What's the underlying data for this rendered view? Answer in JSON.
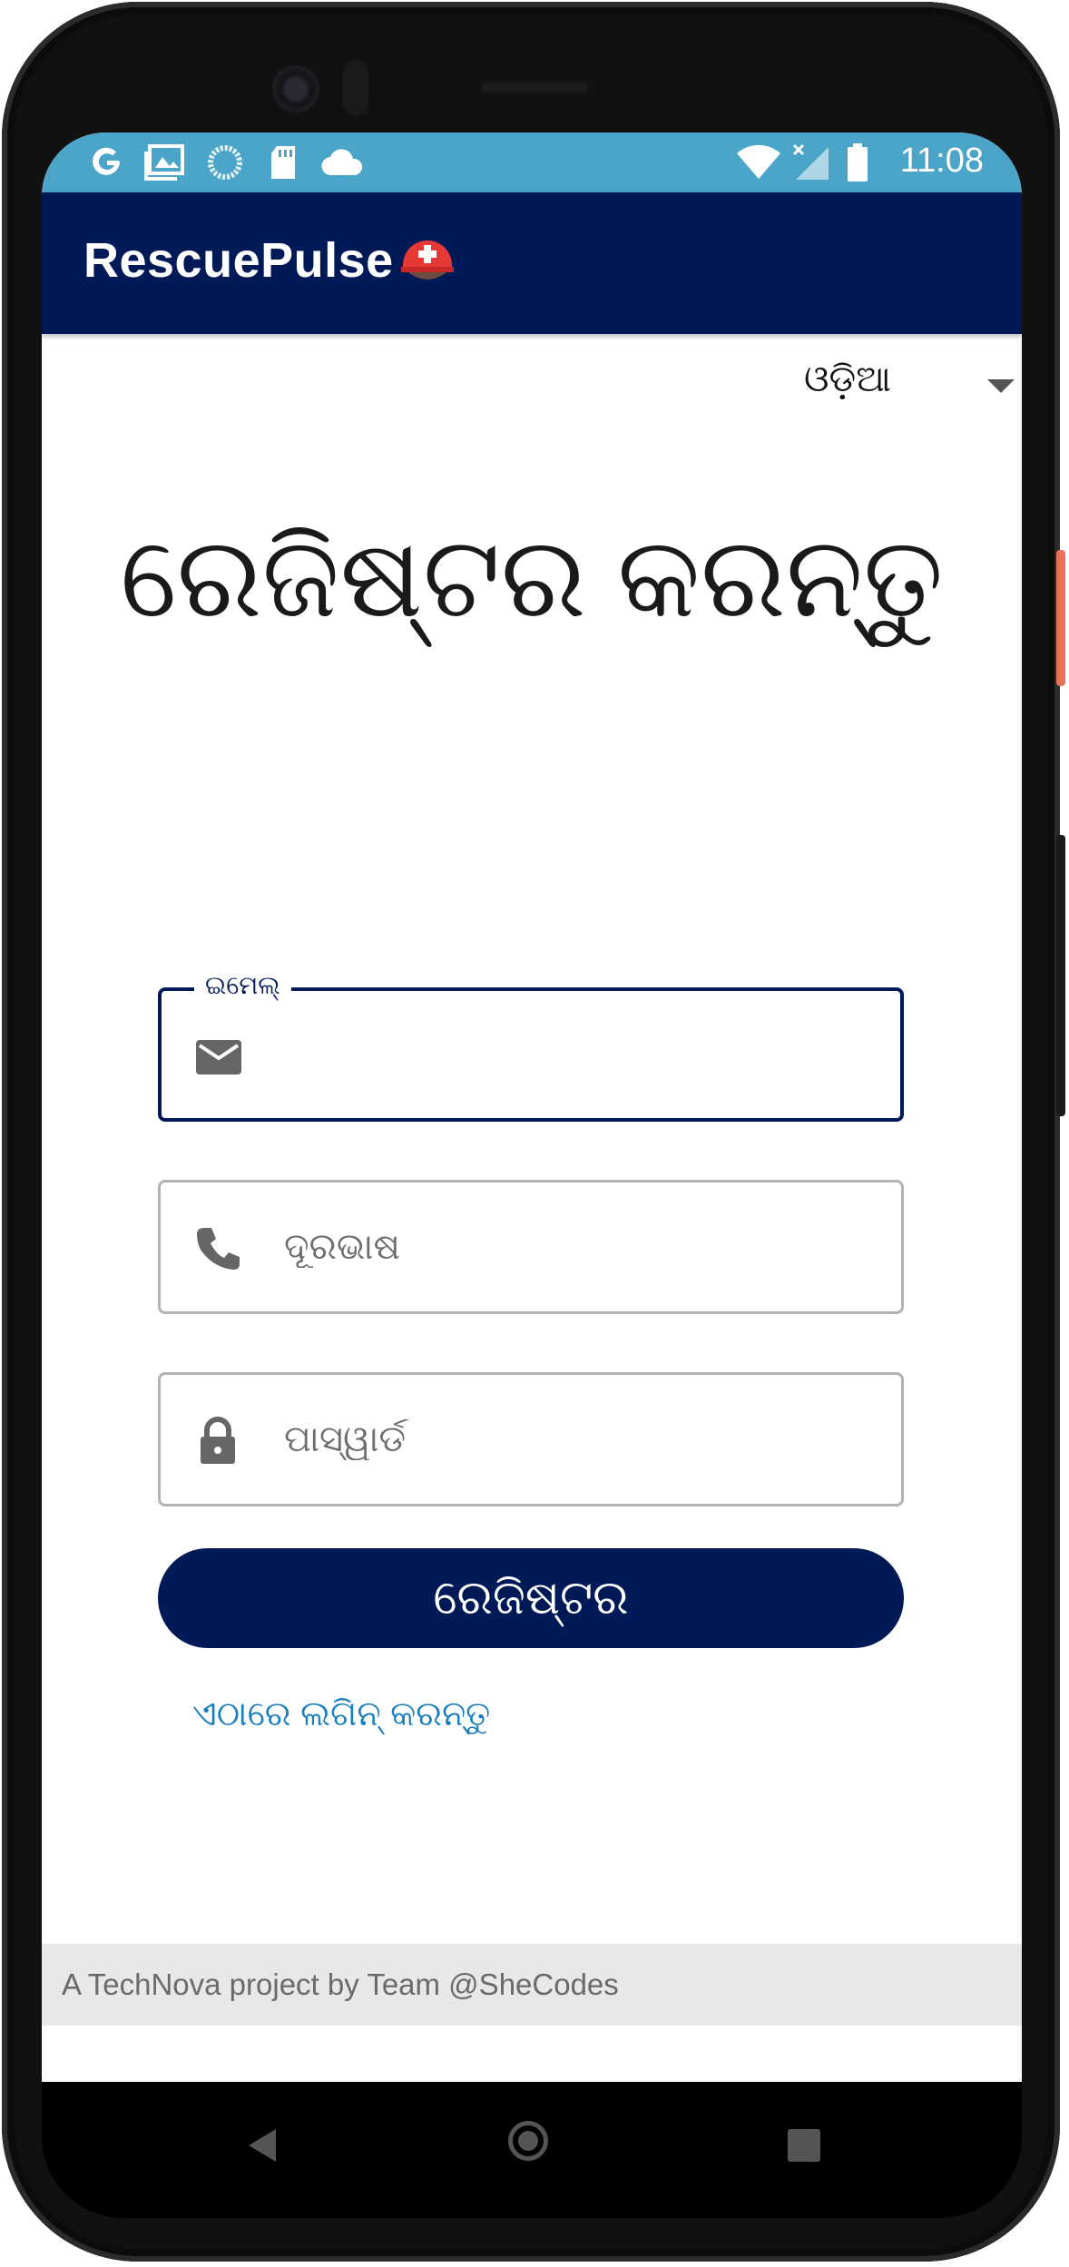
{
  "status_bar": {
    "time": "11:08",
    "left_icons": [
      "google-icon",
      "gallery-icon",
      "loading-icon",
      "sd-card-icon",
      "cloud-icon"
    ],
    "right_icons": [
      "wifi-icon",
      "signal-icon",
      "battery-icon"
    ]
  },
  "app_bar": {
    "title": "RescuePulse",
    "icon": "rescue-helmet-icon"
  },
  "language_selector": {
    "selected": "ଓଡ଼ିଆ"
  },
  "heading": "ରେଜିଷ୍ଟର କରନ୍ତୁ",
  "form": {
    "email": {
      "label": "ଇମେଲ୍",
      "value": "",
      "icon": "mail-icon"
    },
    "phone": {
      "placeholder": "ଦୂରଭାଷ",
      "icon": "phone-icon"
    },
    "password": {
      "placeholder": "ପାସ୍ୱାର୍ଡ",
      "icon": "lock-icon"
    },
    "submit_label": "ରେଜିଷ୍ଟର"
  },
  "login_link": "ଏଠାରେ ଲଗିନ୍ କରନ୍ତୁ",
  "footer": "A TechNova project by Team @SheCodes",
  "colors": {
    "primary": "#001a57",
    "status_bar": "#4ba5c8",
    "link": "#1a7fc1",
    "footer_bg": "#e8e8e8"
  }
}
